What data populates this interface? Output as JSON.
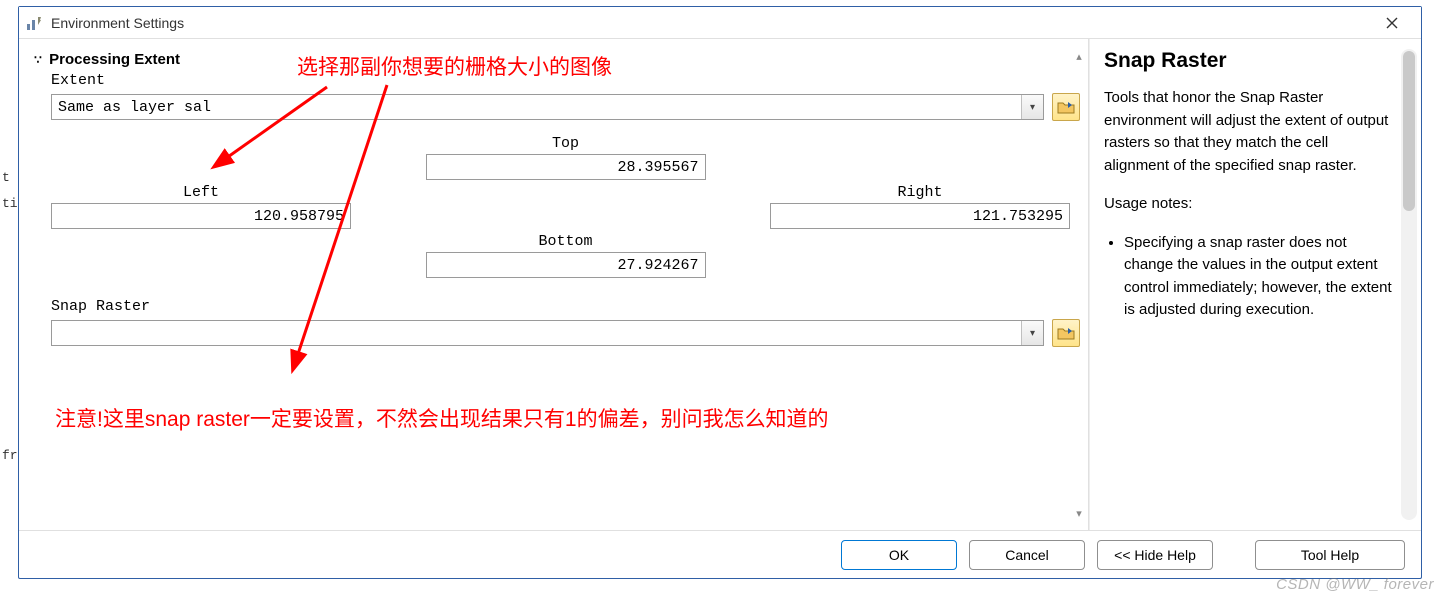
{
  "window": {
    "title": "Environment Settings"
  },
  "section": {
    "name": "Processing Extent",
    "extent_label": "Extent",
    "extent_value": "Same as layer sal",
    "top_label": "Top",
    "top_value": "28.395567",
    "left_label": "Left",
    "left_value": "120.958795",
    "right_label": "Right",
    "right_value": "121.753295",
    "bottom_label": "Bottom",
    "bottom_value": "27.924267",
    "snap_label": "Snap Raster",
    "snap_value": ""
  },
  "annotations": {
    "top_note": "选择那副你想要的栅格大小的图像",
    "bottom_note": "注意!这里snap raster一定要设置，不然会出现结果只有1的偏差，别问我怎么知道的"
  },
  "help": {
    "title": "Snap Raster",
    "para1": "Tools that honor the Snap Raster environment will adjust the extent of output rasters so that they match the cell alignment of the specified snap raster.",
    "usage_heading": "Usage notes:",
    "bullet1": "Specifying a snap raster does not change the values in the output extent control immediately; however, the extent is adjusted during execution."
  },
  "footer": {
    "ok": "OK",
    "cancel": "Cancel",
    "hide_help": "<< Hide Help",
    "tool_help": "Tool Help"
  },
  "watermark": "CSDN @WW_ forever"
}
